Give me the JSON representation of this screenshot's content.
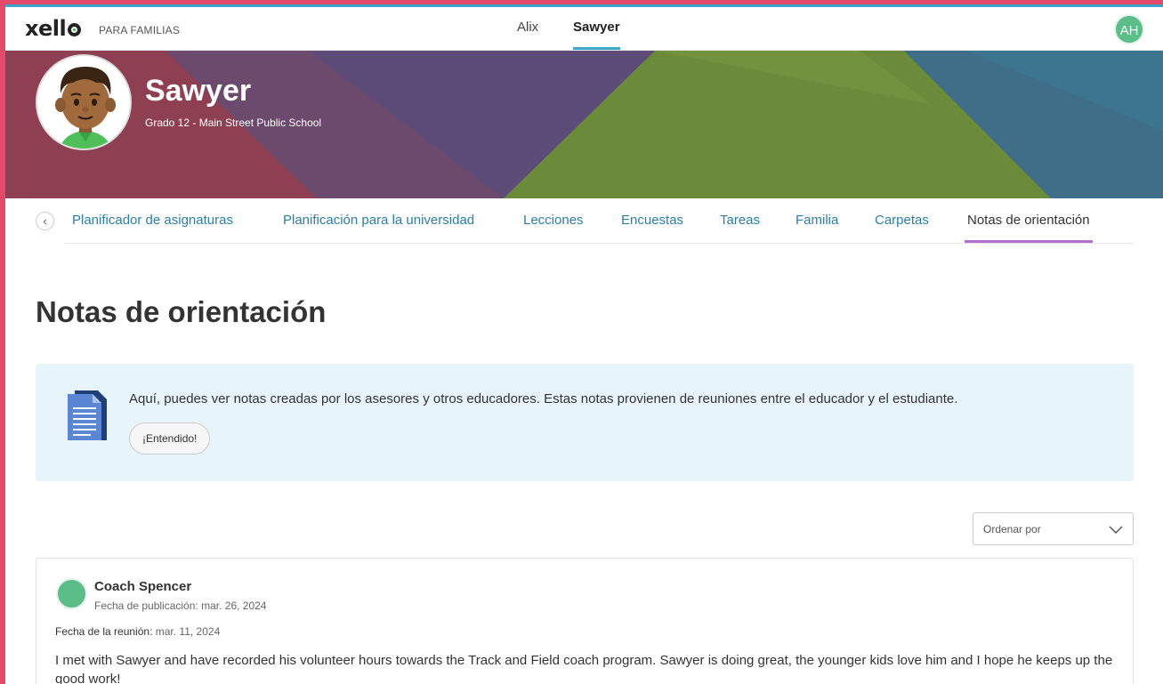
{
  "header": {
    "logo_text": "xello",
    "logo_sub": "PARA FAMILIAS",
    "students": [
      {
        "label": "Alix",
        "active": false
      },
      {
        "label": "Sawyer",
        "active": true
      }
    ],
    "user_initials": "AH"
  },
  "profile": {
    "name": "Sawyer",
    "grade": "Grado 12 - Main Street Public School"
  },
  "nav": {
    "back_icon": "chevron-left-icon",
    "items": [
      {
        "label": "Planificador de asignaturas"
      },
      {
        "label": "Planificación para la universidad"
      },
      {
        "label": "Lecciones"
      },
      {
        "label": "Encuestas"
      },
      {
        "label": "Tareas"
      },
      {
        "label": "Familia"
      },
      {
        "label": "Carpetas"
      },
      {
        "label": "Notas de orientación",
        "active": true
      }
    ]
  },
  "main": {
    "title": "Notas de orientación",
    "info": {
      "icon": "document-icon",
      "text": "Aquí, puedes ver notas creadas por los asesores y otros educadores. Estas notas provienen de reuniones entre el educador y el estudiante.",
      "button": "¡Entendido!"
    },
    "sort": {
      "placeholder": "Ordenar por"
    },
    "notes": [
      {
        "author": "Coach Spencer",
        "published_label": "Fecha de publicación:",
        "published_date": "mar. 26, 2024",
        "meeting_label": "Fecha de la reunión:",
        "meeting_date": "mar. 11, 2024",
        "body": "I met with Sawyer and have recorded his volunteer hours towards the Track and Field coach program. Sawyer is doing great, the younger kids love him and I hope he keeps up the good work!"
      }
    ]
  },
  "colors": {
    "accent": "#3ea6c9",
    "active_tab": "#b26fd0",
    "link": "#2d7ea6",
    "avatar_green": "#5bbd88"
  }
}
